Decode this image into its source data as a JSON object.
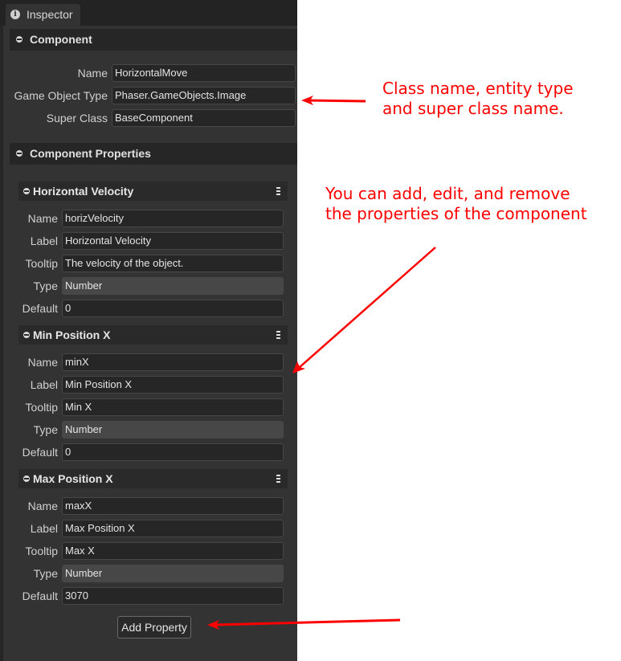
{
  "tab": {
    "label": "Inspector",
    "icon": "info-icon"
  },
  "component_section": {
    "title": "Component",
    "fields": [
      {
        "label": "Name",
        "value": "HorizontalMove"
      },
      {
        "label": "Game Object Type",
        "value": "Phaser.GameObjects.Image"
      },
      {
        "label": "Super Class",
        "value": "BaseComponent"
      }
    ]
  },
  "properties_section": {
    "title": "Component Properties",
    "properties": [
      {
        "title": "Horizontal Velocity",
        "fields": [
          {
            "label": "Name",
            "value": "horizVelocity"
          },
          {
            "label": "Label",
            "value": "Horizontal Velocity"
          },
          {
            "label": "Tooltip",
            "value": "The velocity of the object."
          },
          {
            "label": "Type",
            "value": "Number"
          },
          {
            "label": "Default",
            "value": "0"
          }
        ]
      },
      {
        "title": "Min Position X",
        "fields": [
          {
            "label": "Name",
            "value": "minX"
          },
          {
            "label": "Label",
            "value": "Min Position X"
          },
          {
            "label": "Tooltip",
            "value": "Min X"
          },
          {
            "label": "Type",
            "value": "Number"
          },
          {
            "label": "Default",
            "value": "0"
          }
        ]
      },
      {
        "title": "Max Position X",
        "fields": [
          {
            "label": "Name",
            "value": "maxX"
          },
          {
            "label": "Label",
            "value": "Max Position X"
          },
          {
            "label": "Tooltip",
            "value": "Max X"
          },
          {
            "label": "Type",
            "value": "Number"
          },
          {
            "label": "Default",
            "value": "3070"
          }
        ]
      }
    ],
    "add_button_label": "Add Property"
  },
  "annotations": {
    "note1_line1": "Class name, entity type",
    "note1_line2": "and super class name.",
    "note2_line1": "You can add, edit, and remove",
    "note2_line2": "the properties of the component",
    "color": "#ff0000"
  }
}
